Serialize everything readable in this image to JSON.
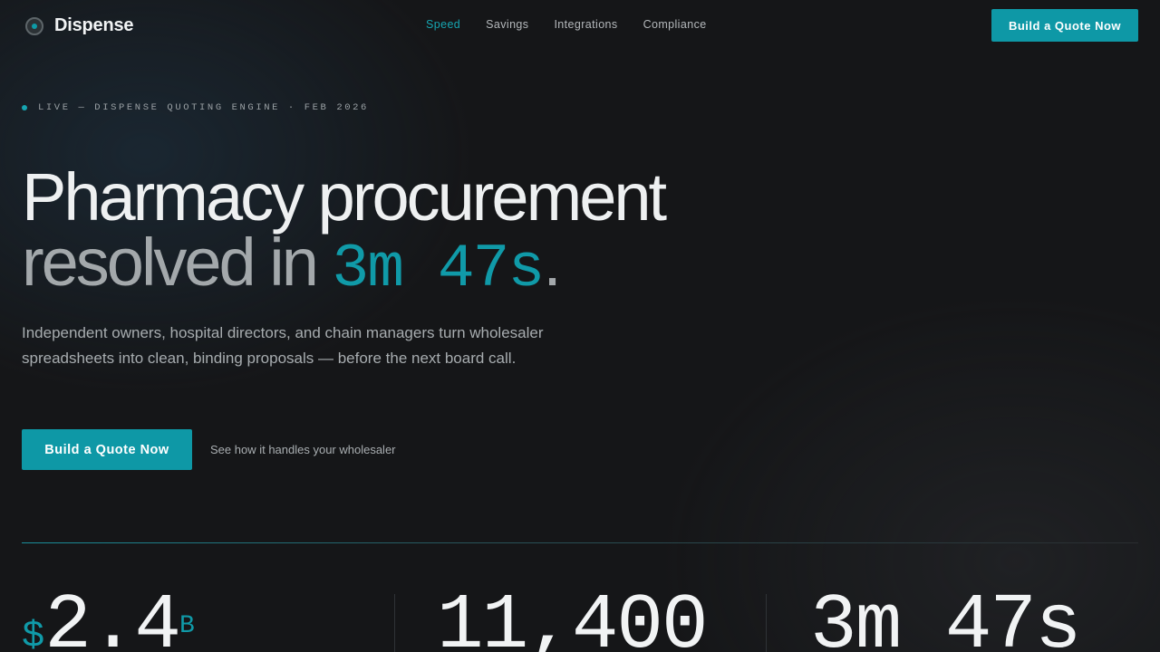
{
  "nav": {
    "brand": "Dispense",
    "links": [
      {
        "label": "Speed",
        "active": true
      },
      {
        "label": "Savings",
        "active": false
      },
      {
        "label": "Integrations",
        "active": false
      },
      {
        "label": "Compliance",
        "active": false
      }
    ],
    "cta": "Build a Quote Now"
  },
  "hero": {
    "live_label": "LIVE — DISPENSE QUOTING ENGINE · FEB 2026",
    "headline_line1": "Pharmacy procurement",
    "headline_line2_prefix": "resolved in ",
    "headline_timer": "3m 47s",
    "headline_end": ".",
    "subtext": "Independent owners, hospital directors, and chain managers turn wholesaler spreadsheets into clean, binding proposals — before the next board call.",
    "cta": "Build a Quote Now",
    "secondary_link": "See how it handles your wholesaler"
  },
  "stats": [
    {
      "prefix": "$",
      "value": "2.4",
      "suffix": "B"
    },
    {
      "value": "11,400"
    },
    {
      "value": "3m 47s"
    }
  ],
  "colors": {
    "accent": "#0e98a6",
    "background": "#151618",
    "text_primary": "#eef0f1",
    "text_muted": "#a7acaf"
  },
  "icons": {
    "brand": "dispense-logo-icon",
    "live": "live-indicator-dot"
  }
}
